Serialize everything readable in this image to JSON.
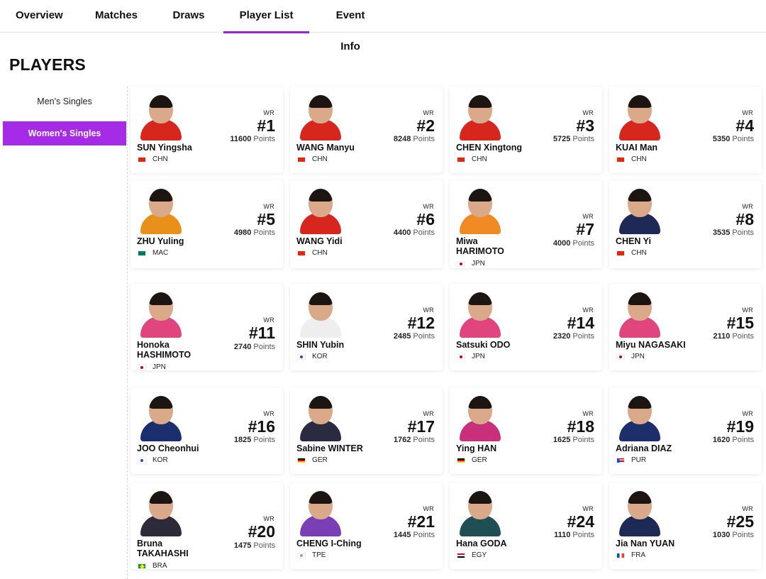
{
  "tabs": [
    {
      "label": "Overview"
    },
    {
      "label": "Matches"
    },
    {
      "label": "Draws"
    },
    {
      "label": "Player List"
    },
    {
      "label": "Event Info"
    }
  ],
  "active_tab": "Player List",
  "heading": "PLAYERS",
  "sidebar": {
    "items": [
      {
        "label": "Men's Singles"
      },
      {
        "label": "Women's Singles"
      }
    ],
    "active": "Women's Singles"
  },
  "colors": {
    "accent": "#a52be6",
    "tab_underline": "#a020d8"
  },
  "players": [
    {
      "first": "SUN Yingsha",
      "second": "",
      "country": "CHN",
      "wr_label": "WR",
      "rank": "#1",
      "points": "11600",
      "points_label": "Points",
      "kit": "#d7261e"
    },
    {
      "first": "WANG Manyu",
      "second": "",
      "country": "CHN",
      "wr_label": "WR",
      "rank": "#2",
      "points": "8248",
      "points_label": "Points",
      "kit": "#d7261e"
    },
    {
      "first": "CHEN Xingtong",
      "second": "",
      "country": "CHN",
      "wr_label": "WR",
      "rank": "#3",
      "points": "5725",
      "points_label": "Points",
      "kit": "#d7261e"
    },
    {
      "first": "KUAI Man",
      "second": "",
      "country": "CHN",
      "wr_label": "WR",
      "rank": "#4",
      "points": "5350",
      "points_label": "Points",
      "kit": "#d7261e"
    },
    {
      "first": "ZHU Yuling",
      "second": "",
      "country": "MAC",
      "wr_label": "WR",
      "rank": "#5",
      "points": "4980",
      "points_label": "Points",
      "kit": "#e8901a"
    },
    {
      "first": "WANG Yidi",
      "second": "",
      "country": "CHN",
      "wr_label": "WR",
      "rank": "#6",
      "points": "4400",
      "points_label": "Points",
      "kit": "#d7261e"
    },
    {
      "first": "Miwa",
      "second": "HARIMOTO",
      "country": "JPN",
      "wr_label": "WR",
      "rank": "#7",
      "points": "4000",
      "points_label": "Points",
      "kit": "#f08a24"
    },
    {
      "first": "CHEN Yi",
      "second": "",
      "country": "CHN",
      "wr_label": "WR",
      "rank": "#8",
      "points": "3535",
      "points_label": "Points",
      "kit": "#1e2a55"
    },
    {
      "first": "Honoka",
      "second": "HASHIMOTO",
      "country": "JPN",
      "wr_label": "WR",
      "rank": "#11",
      "points": "2740",
      "points_label": "Points",
      "kit": "#e0457e"
    },
    {
      "first": "SHIN Yubin",
      "second": "",
      "country": "KOR",
      "wr_label": "WR",
      "rank": "#12",
      "points": "2485",
      "points_label": "Points",
      "kit": "#eeeeee"
    },
    {
      "first": "Satsuki ODO",
      "second": "",
      "country": "JPN",
      "wr_label": "WR",
      "rank": "#14",
      "points": "2320",
      "points_label": "Points",
      "kit": "#e0457e"
    },
    {
      "first": "Miyu NAGASAKI",
      "second": "",
      "country": "JPN",
      "wr_label": "WR",
      "rank": "#15",
      "points": "2110",
      "points_label": "Points",
      "kit": "#e0457e"
    },
    {
      "first": "JOO Cheonhui",
      "second": "",
      "country": "KOR",
      "wr_label": "WR",
      "rank": "#16",
      "points": "1825",
      "points_label": "Points",
      "kit": "#1b2f6e"
    },
    {
      "first": "Sabine WINTER",
      "second": "",
      "country": "GER",
      "wr_label": "WR",
      "rank": "#17",
      "points": "1762",
      "points_label": "Points",
      "kit": "#2a2a40"
    },
    {
      "first": "Ying HAN",
      "second": "",
      "country": "GER",
      "wr_label": "WR",
      "rank": "#18",
      "points": "1625",
      "points_label": "Points",
      "kit": "#c8307a"
    },
    {
      "first": "Adriana DIAZ",
      "second": "",
      "country": "PUR",
      "wr_label": "WR",
      "rank": "#19",
      "points": "1620",
      "points_label": "Points",
      "kit": "#1d2f6b"
    },
    {
      "first": "Bruna",
      "second": "TAKAHASHI",
      "country": "BRA",
      "wr_label": "WR",
      "rank": "#20",
      "points": "1475",
      "points_label": "Points",
      "kit": "#2d2a3a"
    },
    {
      "first": "CHENG I-Ching",
      "second": "",
      "country": "TPE",
      "wr_label": "WR",
      "rank": "#21",
      "points": "1445",
      "points_label": "Points",
      "kit": "#7a3fb5"
    },
    {
      "first": "Hana GODA",
      "second": "",
      "country": "EGY",
      "wr_label": "WR",
      "rank": "#24",
      "points": "1110",
      "points_label": "Points",
      "kit": "#1f4f55"
    },
    {
      "first": "Jia Nan YUAN",
      "second": "",
      "country": "FRA",
      "wr_label": "WR",
      "rank": "#25",
      "points": "1030",
      "points_label": "Points",
      "kit": "#1c2a55"
    }
  ]
}
